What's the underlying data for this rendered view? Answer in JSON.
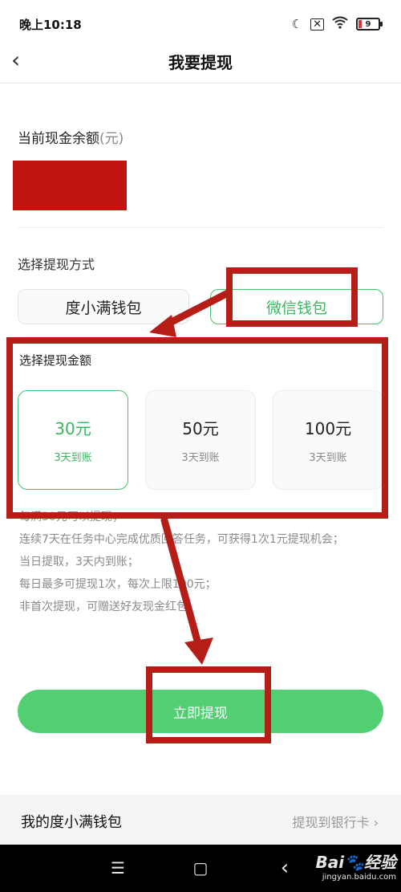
{
  "status_bar": {
    "time": "晚上10:18",
    "icons": [
      "moon-icon",
      "sim-off-icon",
      "wifi-icon",
      "battery-icon"
    ],
    "battery_level": "9"
  },
  "header": {
    "title": "我要提现",
    "back_glyph": "‹"
  },
  "balance": {
    "label": "当前现金余额",
    "unit": "(元)"
  },
  "method": {
    "label": "选择提现方式",
    "options": [
      {
        "label": "度小满钱包",
        "selected": false
      },
      {
        "label": "微信钱包",
        "selected": true
      }
    ]
  },
  "amount": {
    "label": "选择提现金额",
    "options": [
      {
        "value": "30元",
        "arrival": "3天到账",
        "selected": true
      },
      {
        "value": "50元",
        "arrival": "3天到账",
        "selected": false
      },
      {
        "value": "100元",
        "arrival": "3天到账",
        "selected": false
      }
    ]
  },
  "rules": [
    "每满30元可以提现；",
    "连续7天在任务中心完成优质回答任务，可获得1次1元提现机会；",
    "当日提取，3天内到账；",
    "每日最多可提现1次，每次上限100元；",
    "非首次提现，可赠送好友现金红包"
  ],
  "submit": {
    "label": "立即提现"
  },
  "wallet": {
    "title": "我的度小满钱包",
    "link": "提现到银行卡 ›"
  },
  "nav_bar": {
    "menu_glyph": "☰",
    "home_glyph": "▢",
    "back_glyph": "‹",
    "watermark_logo": "Bai🐾经验",
    "watermark_url": "jingyan.baidu.com"
  },
  "colors": {
    "accent_green": "#52cf73",
    "annotation_red": "#b51d17"
  }
}
